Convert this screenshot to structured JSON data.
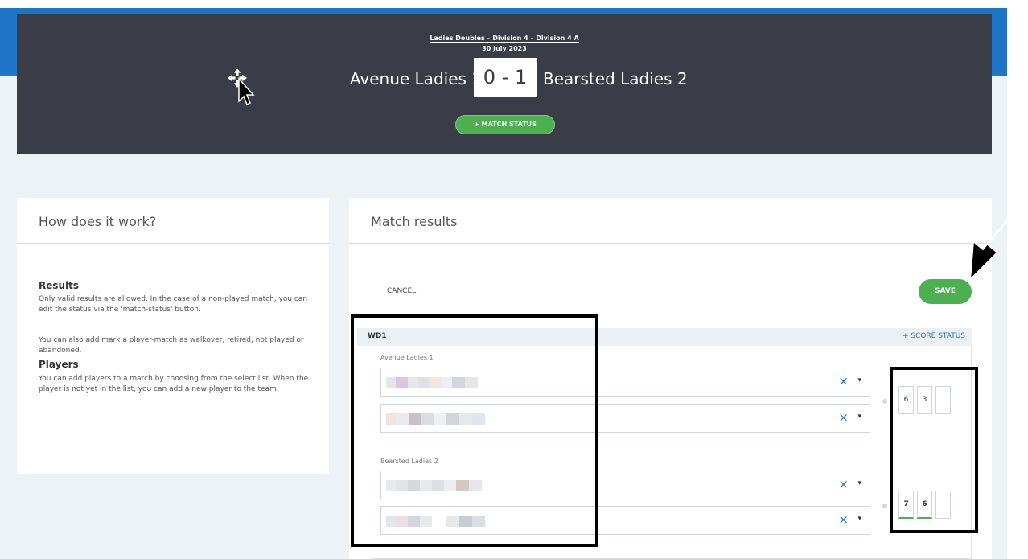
{
  "header": {
    "division": "Ladies Doubles – Division 4 – Division 4 A",
    "date": "30 July 2023",
    "home_team": "Avenue Ladies 1",
    "score": "0 - 1",
    "away_team": "Bearsted Ladies 2",
    "match_status_label": "+ MATCH STATUS"
  },
  "help": {
    "title": "How does it work?",
    "results_heading": "Results",
    "results_text_1": "Only valid results are allowed. In the case of a non-played match, you can edit the status via the 'match-status' button.",
    "results_text_2": "You can also add mark a player-match as walkover, retired, not played or abandoned.",
    "players_heading": "Players",
    "players_text": "You can add players to a match by choosing from the select list. When the player is not yet in the list, you can add a new player to the team."
  },
  "results": {
    "title": "Match results",
    "cancel_label": "CANCEL",
    "save_label": "SAVE",
    "match_code": "WD1",
    "score_status_label": "+ SCORE STATUS",
    "home_team": "Avenue Ladies 1",
    "away_team": "Bearsted Ladies 2",
    "clear_icon": "×",
    "caret_icon": "▾",
    "home_scores": [
      "6",
      "3",
      ""
    ],
    "away_scores": [
      "7",
      "6",
      ""
    ]
  },
  "colors": {
    "accent_blue": "#1e74c6",
    "header_bg": "#3a3d47",
    "green": "#4caf50"
  }
}
